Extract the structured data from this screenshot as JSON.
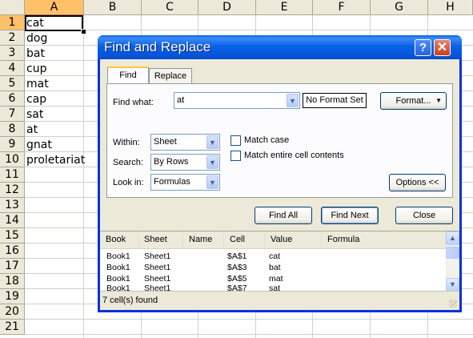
{
  "sheet": {
    "columns": [
      "A",
      "B",
      "C",
      "D",
      "E",
      "F",
      "G",
      "H"
    ],
    "rows": [
      "1",
      "2",
      "3",
      "4",
      "5",
      "6",
      "7",
      "8",
      "9",
      "10",
      "11",
      "12",
      "13",
      "14",
      "15",
      "16",
      "17",
      "18",
      "19",
      "20",
      "21"
    ],
    "cells_a": [
      "cat",
      "dog",
      "bat",
      "cup",
      "mat",
      "cap",
      "sat",
      "at",
      "gnat",
      "proletariat"
    ]
  },
  "dialog": {
    "title": "Find and Replace",
    "help_icon": "?",
    "close_icon": "✕",
    "tabs": [
      "Find",
      "Replace"
    ],
    "find_what_label": "Find what:",
    "find_what_value": "at",
    "no_format_label": "No Format Set",
    "format_button": "Format...",
    "within_label": "Within:",
    "within_value": "Sheet",
    "search_label": "Search:",
    "search_value": "By Rows",
    "lookin_label": "Look in:",
    "lookin_value": "Formulas",
    "match_case_label": "Match case",
    "match_entire_label": "Match entire cell contents",
    "options_button": "Options <<",
    "find_all_button": "Find All",
    "find_next_button": "Find Next",
    "close_button": "Close",
    "results_headers": [
      "Book",
      "Sheet",
      "Name",
      "Cell",
      "Value",
      "Formula"
    ],
    "results_rows": [
      [
        "Book1",
        "Sheet1",
        "",
        "$A$1",
        "cat",
        ""
      ],
      [
        "Book1",
        "Sheet1",
        "",
        "$A$3",
        "bat",
        ""
      ],
      [
        "Book1",
        "Sheet1",
        "",
        "$A$5",
        "mat",
        ""
      ],
      [
        "Book1",
        "Sheet1",
        "",
        "$A$7",
        "sat",
        ""
      ]
    ],
    "status_text": "7 cell(s) found"
  },
  "colors": {
    "titlebar": "#0A5FE4",
    "dialog_bg": "#ECE9D8",
    "selected_header": "#FFC06A"
  }
}
